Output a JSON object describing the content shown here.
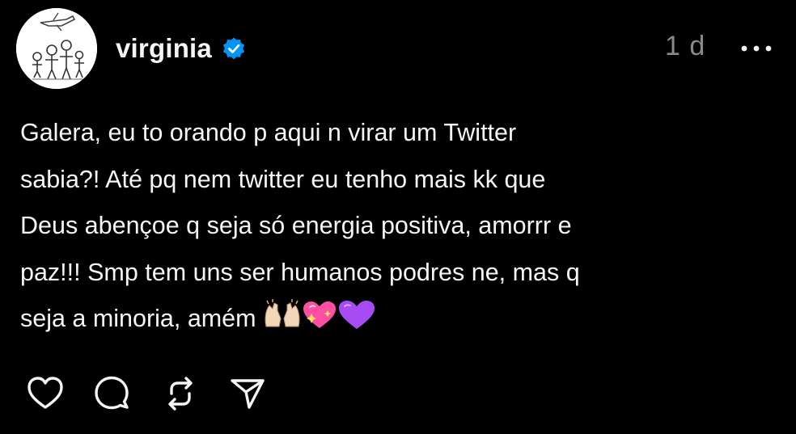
{
  "post": {
    "author": {
      "username": "virginia",
      "avatar_icon": "family-drawing-avatar",
      "verified": true,
      "verified_color": "#0095f6"
    },
    "timestamp": "1 d",
    "more_icon": "more-horizontal-icon",
    "text_lines": [
      "Galera, eu to orando p aqui n virar um Twitter",
      "sabia?! Até pq nem twitter eu tenho mais kk que",
      "Deus abençoe q seja só energia positiva, amorrr e",
      "paz!!! Smp tem uns ser humanos podres ne, mas q",
      "seja a minoria, amém"
    ],
    "emojis": [
      "raising-hands-emoji",
      "sparkling-heart-emoji",
      "purple-heart-emoji"
    ],
    "actions": [
      {
        "name": "like-button",
        "icon": "heart-icon"
      },
      {
        "name": "comment-button",
        "icon": "comment-icon"
      },
      {
        "name": "repost-button",
        "icon": "repost-icon"
      },
      {
        "name": "share-button",
        "icon": "send-icon"
      }
    ]
  },
  "colors": {
    "background": "#000000",
    "text": "#f3f5f7",
    "muted": "#8a8a8a",
    "verified": "#0095f6"
  }
}
